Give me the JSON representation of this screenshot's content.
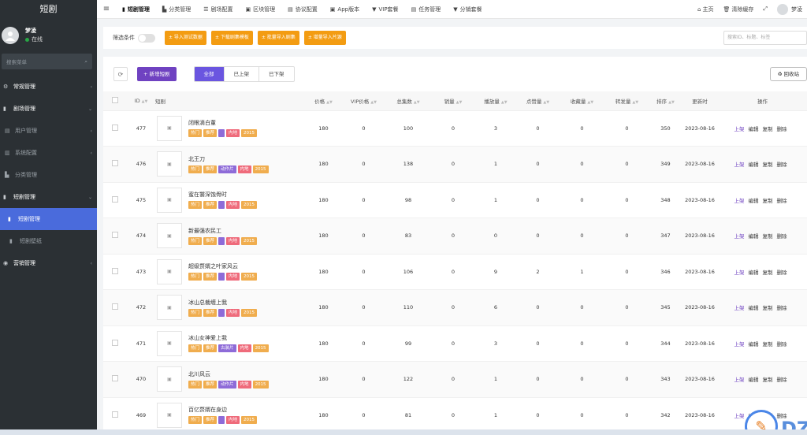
{
  "sidebar": {
    "brand": "短剧",
    "user": {
      "name": "梦凌",
      "status": "在线"
    },
    "search_placeholder": "搜索菜单",
    "items": [
      {
        "label": "常规管理",
        "type": "header",
        "chevron": "‹"
      },
      {
        "label": "剧场管理",
        "type": "header",
        "chevron": "⌄"
      },
      {
        "label": "用户管理",
        "type": "sub",
        "chevron": "‹"
      },
      {
        "label": "系统配置",
        "type": "sub",
        "chevron": "‹"
      },
      {
        "label": "分类管理",
        "type": "sub",
        "chevron": ""
      },
      {
        "label": "短剧管理",
        "type": "header",
        "chevron": "⌄"
      },
      {
        "label": "短剧管理",
        "type": "active",
        "chevron": ""
      },
      {
        "label": "短剧壁纸",
        "type": "sub2",
        "chevron": ""
      },
      {
        "label": "营销管理",
        "type": "header",
        "chevron": "‹"
      }
    ]
  },
  "topbar": {
    "tabs": [
      "短剧管理",
      "分类管理",
      "剧场配置",
      "区块管理",
      "协议配置",
      "App版本",
      "VIP套餐",
      "任务管理",
      "分销套餐"
    ],
    "home": "主页",
    "clear_cache": "清除缓存",
    "username": "梦凌"
  },
  "filter": {
    "label": "筛选条件",
    "buttons": [
      "± 导入测试数据",
      "± 下载剧集模板",
      "± 批量导入剧集",
      "± 增量导入片源"
    ],
    "search_placeholder": "搜索ID、标题、标签"
  },
  "toolbar": {
    "add_label": "+ 新增短剧",
    "segments": [
      "全部",
      "已上架",
      "已下架"
    ],
    "recycle_label": "♻ 回收站"
  },
  "table": {
    "headers": [
      "ID",
      "短剧",
      "价格",
      "VIP价格",
      "总集数",
      "销量",
      "播放量",
      "点赞量",
      "收藏量",
      "转发量",
      "排序",
      "更新时",
      "操作"
    ],
    "ops": [
      "上架",
      "编辑",
      "复制",
      "删除"
    ],
    "rows": [
      {
        "id": "477",
        "name": "闭眼滴白董",
        "tags": [
          "热门",
          "推荐",
          "",
          "内地",
          "2015"
        ],
        "price": "180",
        "vip": "0",
        "episodes": "100",
        "sales": "0",
        "plays": "3",
        "likes": "0",
        "favs": "0",
        "shares": "0",
        "sort": "350",
        "updated": "2023-08-16"
      },
      {
        "id": "476",
        "name": "北王刀",
        "tags": [
          "热门",
          "推荐",
          "动作片",
          "内地",
          "2015"
        ],
        "price": "180",
        "vip": "0",
        "episodes": "138",
        "sales": "0",
        "plays": "1",
        "likes": "0",
        "favs": "0",
        "shares": "0",
        "sort": "349",
        "updated": "2023-08-16"
      },
      {
        "id": "475",
        "name": "蜜在饕深蚀骨时",
        "tags": [
          "热门",
          "推荐",
          "",
          "内地",
          "2015"
        ],
        "price": "180",
        "vip": "0",
        "episodes": "98",
        "sales": "0",
        "plays": "1",
        "likes": "0",
        "favs": "0",
        "shares": "0",
        "sort": "348",
        "updated": "2023-08-16"
      },
      {
        "id": "474",
        "name": "新最强农民工",
        "tags": [
          "热门",
          "推荐",
          "",
          "内地",
          "2015"
        ],
        "price": "180",
        "vip": "0",
        "episodes": "83",
        "sales": "0",
        "plays": "0",
        "likes": "0",
        "favs": "0",
        "shares": "0",
        "sort": "347",
        "updated": "2023-08-16"
      },
      {
        "id": "473",
        "name": "超级赘婿之叶家风云",
        "tags": [
          "热门",
          "推荐",
          "",
          "内地",
          "2015"
        ],
        "price": "180",
        "vip": "0",
        "episodes": "106",
        "sales": "0",
        "plays": "9",
        "likes": "2",
        "favs": "1",
        "shares": "0",
        "sort": "346",
        "updated": "2023-08-16"
      },
      {
        "id": "472",
        "name": "冰山总裁缠上我",
        "tags": [
          "热门",
          "推荐",
          "",
          "内地",
          "2015"
        ],
        "price": "180",
        "vip": "0",
        "episodes": "110",
        "sales": "0",
        "plays": "6",
        "likes": "0",
        "favs": "0",
        "shares": "0",
        "sort": "345",
        "updated": "2023-08-16"
      },
      {
        "id": "471",
        "name": "冰山女神爱上我",
        "tags": [
          "热门",
          "推荐",
          "古装片",
          "内地",
          "2015"
        ],
        "price": "180",
        "vip": "0",
        "episodes": "99",
        "sales": "0",
        "plays": "3",
        "likes": "0",
        "favs": "0",
        "shares": "0",
        "sort": "344",
        "updated": "2023-08-16"
      },
      {
        "id": "470",
        "name": "北川风云",
        "tags": [
          "热门",
          "推荐",
          "动作片",
          "内地",
          "2015"
        ],
        "price": "180",
        "vip": "0",
        "episodes": "122",
        "sales": "0",
        "plays": "1",
        "likes": "0",
        "favs": "0",
        "shares": "0",
        "sort": "343",
        "updated": "2023-08-16"
      },
      {
        "id": "469",
        "name": "百亿赘婿在身边",
        "tags": [
          "热门",
          "推荐",
          "",
          "内地",
          "2015"
        ],
        "price": "180",
        "vip": "0",
        "episodes": "81",
        "sales": "0",
        "plays": "1",
        "likes": "0",
        "favs": "0",
        "shares": "0",
        "sort": "342",
        "updated": "2023-08-16"
      }
    ]
  },
  "watermark": {
    "mark": "✎",
    "text": "DZ插件网"
  },
  "colors": {
    "sidebar": "#2b3034",
    "accent": "#6f42c1",
    "active_nav": "#4a6bdc",
    "orange": "#f39c12"
  }
}
